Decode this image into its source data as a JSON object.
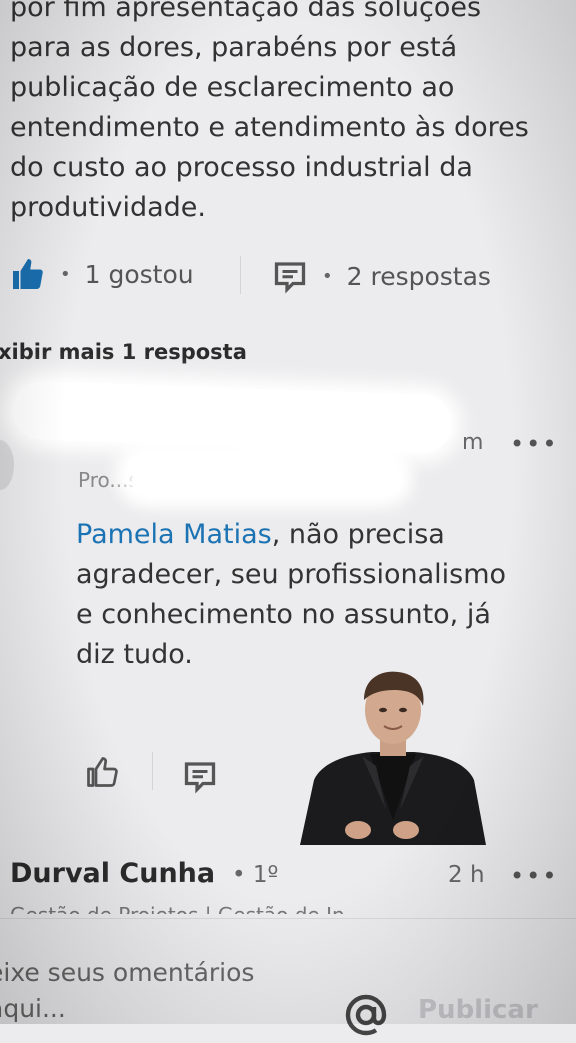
{
  "comment": {
    "text": "por fim apresentação das soluções para as dores, parabéns por está publicação de esclarecimento ao entendimento e atendimento às dores do custo ao processo industrial da produtividade.",
    "like_count": "1 gostou",
    "reply_count": "2 respostas",
    "bullet": "•"
  },
  "show_more": "xibir mais 1 resposta",
  "reply": {
    "time_ago_partial": "m",
    "headline_partial": "Pro...s G...",
    "mention": "Pamela Matias",
    "body": ", não precisa agradecer, seu profissionalismo e conhecimento no assunto, já diz tudo."
  },
  "next_comment": {
    "author": "Durval Cunha",
    "degree": "• 1º",
    "time_ago": "2 h",
    "headline": "Gestão de Projetos | Gestão de In..."
  },
  "composer": {
    "placeholder": "eixe seus omentários aqui...",
    "publish_label": "Publicar"
  },
  "more_label": "•••",
  "colors": {
    "accent": "#1c73b3",
    "icon": "#1a6fb0"
  }
}
